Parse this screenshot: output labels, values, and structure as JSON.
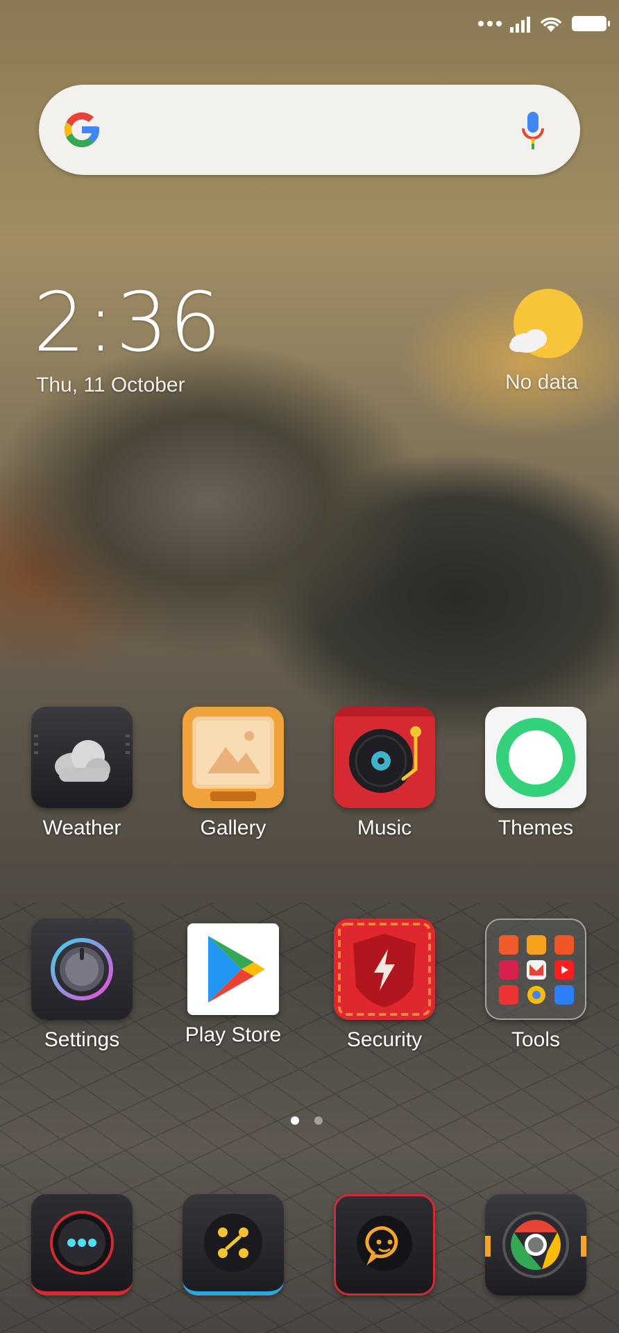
{
  "status_bar": {
    "icons": [
      "more-dots-icon",
      "signal-icon",
      "wifi-icon",
      "battery-icon"
    ]
  },
  "search_bar": {
    "logo_icon": "google-g-icon",
    "mic_icon": "microphone-icon"
  },
  "clock_widget": {
    "time": "2:36",
    "date": "Thu, 11 October"
  },
  "weather_widget": {
    "icon": "sun-cloud-icon",
    "status": "No data"
  },
  "home_apps": [
    {
      "label": "Weather",
      "icon": "weather-cloud-icon"
    },
    {
      "label": "Gallery",
      "icon": "gallery-picture-icon"
    },
    {
      "label": "Music",
      "icon": "music-turntable-icon"
    },
    {
      "label": "Themes",
      "icon": "themes-ring-icon"
    },
    {
      "label": "Settings",
      "icon": "settings-knob-icon"
    },
    {
      "label": "Play Store",
      "icon": "play-store-icon"
    },
    {
      "label": "Security",
      "icon": "security-shield-icon"
    },
    {
      "label": "Tools",
      "icon": "tools-folder-icon"
    }
  ],
  "page_indicator": {
    "pages": 2,
    "current": 1
  },
  "dock_apps": [
    {
      "icon": "phone-dialer-icon"
    },
    {
      "icon": "app-drawer-icon"
    },
    {
      "icon": "messages-chat-icon"
    },
    {
      "icon": "chrome-browser-icon"
    }
  ],
  "colors": {
    "accent_red": "#d52a32",
    "themes_green": "#33d17a",
    "weather_sun": "#f6c53a",
    "gallery_orange": "#f0a23b"
  }
}
